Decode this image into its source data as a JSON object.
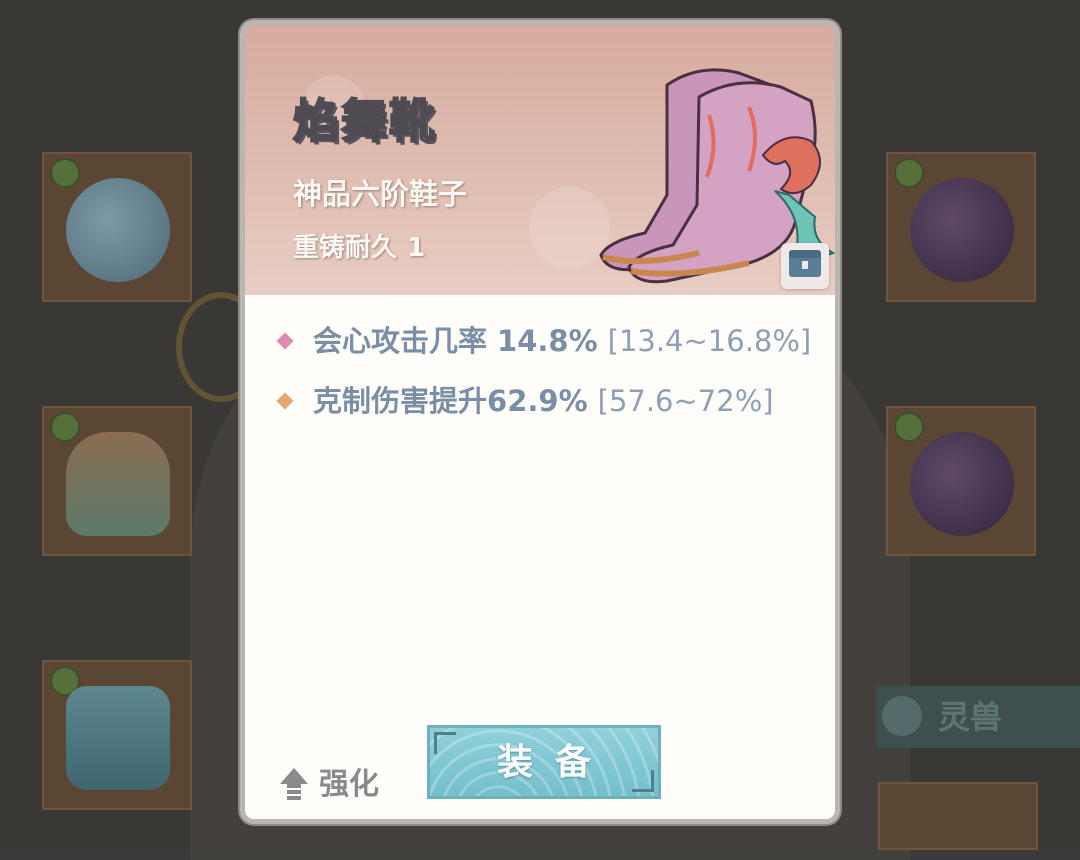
{
  "item": {
    "name": "焰舞靴",
    "grade": "神品六阶鞋子",
    "durability_label": "重铸耐久",
    "durability_value": "1"
  },
  "stats": [
    {
      "label": "会心攻击几率",
      "value": "14.8%",
      "range": "[13.4~16.8%]",
      "color": "#e08aae"
    },
    {
      "label": "克制伤害提升",
      "value": "62.9%",
      "range": "[57.6~72%]",
      "color": "#e2a770"
    }
  ],
  "actions": {
    "upgrade_label": "强化",
    "equip_label": "装备"
  },
  "background": {
    "spirit_tab_label": "灵兽"
  },
  "colors": {
    "stat_text": "#7a8ea6",
    "equip_button": "#8fd0da",
    "header": "#d6ab9e"
  },
  "icons": [
    "chest-icon",
    "upgrade-arrow-icon",
    "item-boots-icon"
  ]
}
